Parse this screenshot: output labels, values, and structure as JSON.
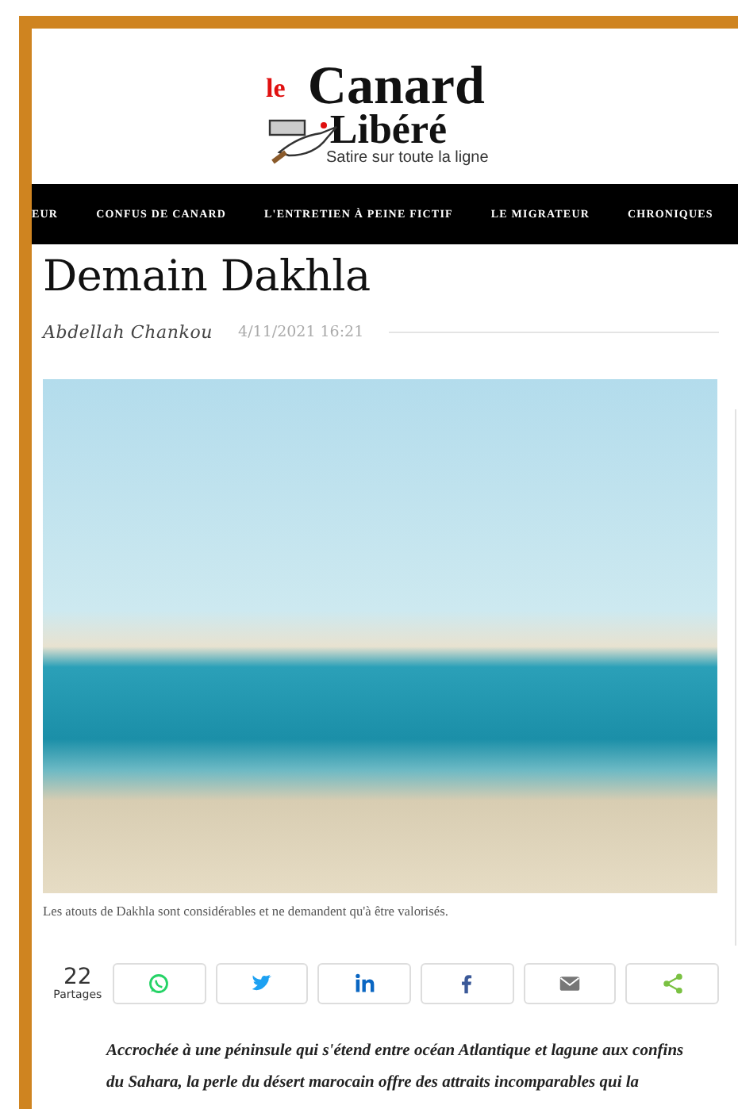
{
  "logo": {
    "prefix": "le",
    "name_line_1": "Canard",
    "name_line_2": "Libéré",
    "tagline": "Satire sur toute la ligne"
  },
  "nav": [
    {
      "label": "EUR"
    },
    {
      "label": "CONFUS DE CANARD"
    },
    {
      "label": "L'ENTRETIEN À PEINE FICTIF"
    },
    {
      "label": "LE MIGRATEUR"
    },
    {
      "label": "CHRONIQUES"
    }
  ],
  "article": {
    "title": "Demain Dakhla",
    "author": "Abdellah Chankou",
    "date": "4/11/2021 16:21",
    "caption": "Les atouts de Dakhla sont considérables et ne demandent qu'à être valorisés.",
    "share_count": "22",
    "share_label": "Partages",
    "share_buttons": [
      {
        "kind": "whatsapp"
      },
      {
        "kind": "twitter"
      },
      {
        "kind": "linkedin"
      },
      {
        "kind": "facebook"
      },
      {
        "kind": "email"
      },
      {
        "kind": "share"
      }
    ],
    "lead": "Accrochée à une péninsule qui s'étend entre océan Atlantique et lagune aux confins du Sahara, la perle du désert marocain offre des attraits incomparables qui la"
  }
}
